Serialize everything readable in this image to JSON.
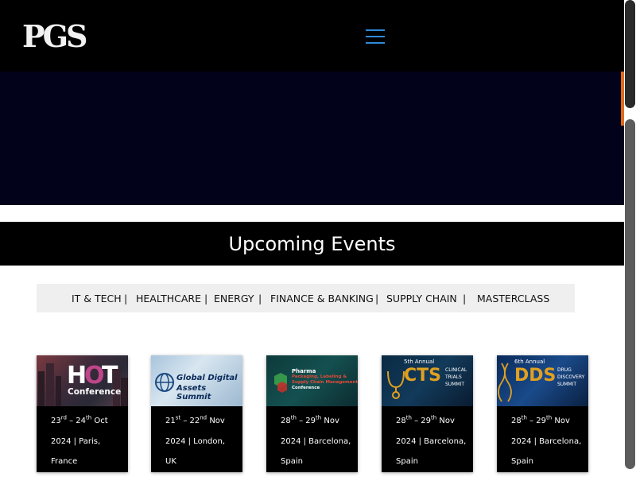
{
  "header": {
    "logo_text": "PGS",
    "menu_icon": "hamburger-icon"
  },
  "events": {
    "title": "Upcoming Events"
  },
  "filters": [
    {
      "label": "IT & TECH"
    },
    {
      "label": "HEALTHCARE"
    },
    {
      "label": "ENERGY"
    },
    {
      "label": "FINANCE & BANKING"
    },
    {
      "label": "SUPPLY CHAIN"
    },
    {
      "label": "MASTERCLASS"
    }
  ],
  "separator": "|",
  "cards": [
    {
      "img_line1": "H",
      "img_mark": "O",
      "img_line2": "T",
      "img_line3": "Conference",
      "d1": "23",
      "s1": "rd",
      "d2": "24",
      "s2": "th",
      "month": "Oct",
      "year_loc": "2024 | Paris,",
      "line3": "France"
    },
    {
      "img_line1": "Global Digital",
      "img_line2": "Assets Summit",
      "d1": "21",
      "s1": "st",
      "d2": "22",
      "s2": "nd",
      "month": "Nov",
      "year_loc": "2024 | London,",
      "line3": "UK"
    },
    {
      "img_line1": "Pharma",
      "img_line2": "Packaging, Labeling &",
      "img_line3": "Supply Chain Management",
      "img_line4": "Conference",
      "d1": "28",
      "s1": "th",
      "d2": "29",
      "s2": "th",
      "month": "Nov",
      "year_loc": "2024 | Barcelona,",
      "line3": "Spain"
    },
    {
      "img_line1": "5th Annual",
      "img_line2": "CTS",
      "img_line3": "CLINICAL",
      "img_line4": "TRIALS",
      "img_line5": "SUMMIT",
      "d1": "28",
      "s1": "th",
      "d2": "29",
      "s2": "th",
      "month": "Nov",
      "year_loc": "2024 | Barcelona,",
      "line3": "Spain"
    },
    {
      "img_line1": "6th Annual",
      "img_line2": "DDS",
      "img_line3": "DRUG",
      "img_line4": "DISCOVERY",
      "img_line5": "SUMMIT",
      "d1": "28",
      "s1": "th",
      "d2": "29",
      "s2": "th",
      "month": "Nov",
      "year_loc": "2024 | Barcelona,",
      "line3": "Spain"
    }
  ],
  "date_dash": " – ",
  "colors": {
    "accent_blue": "#2e8ad8",
    "hero_bg": "#02021a",
    "hero_accent": "#e06a1c",
    "bar_bg": "#000000",
    "filter_bg": "#efefef"
  }
}
